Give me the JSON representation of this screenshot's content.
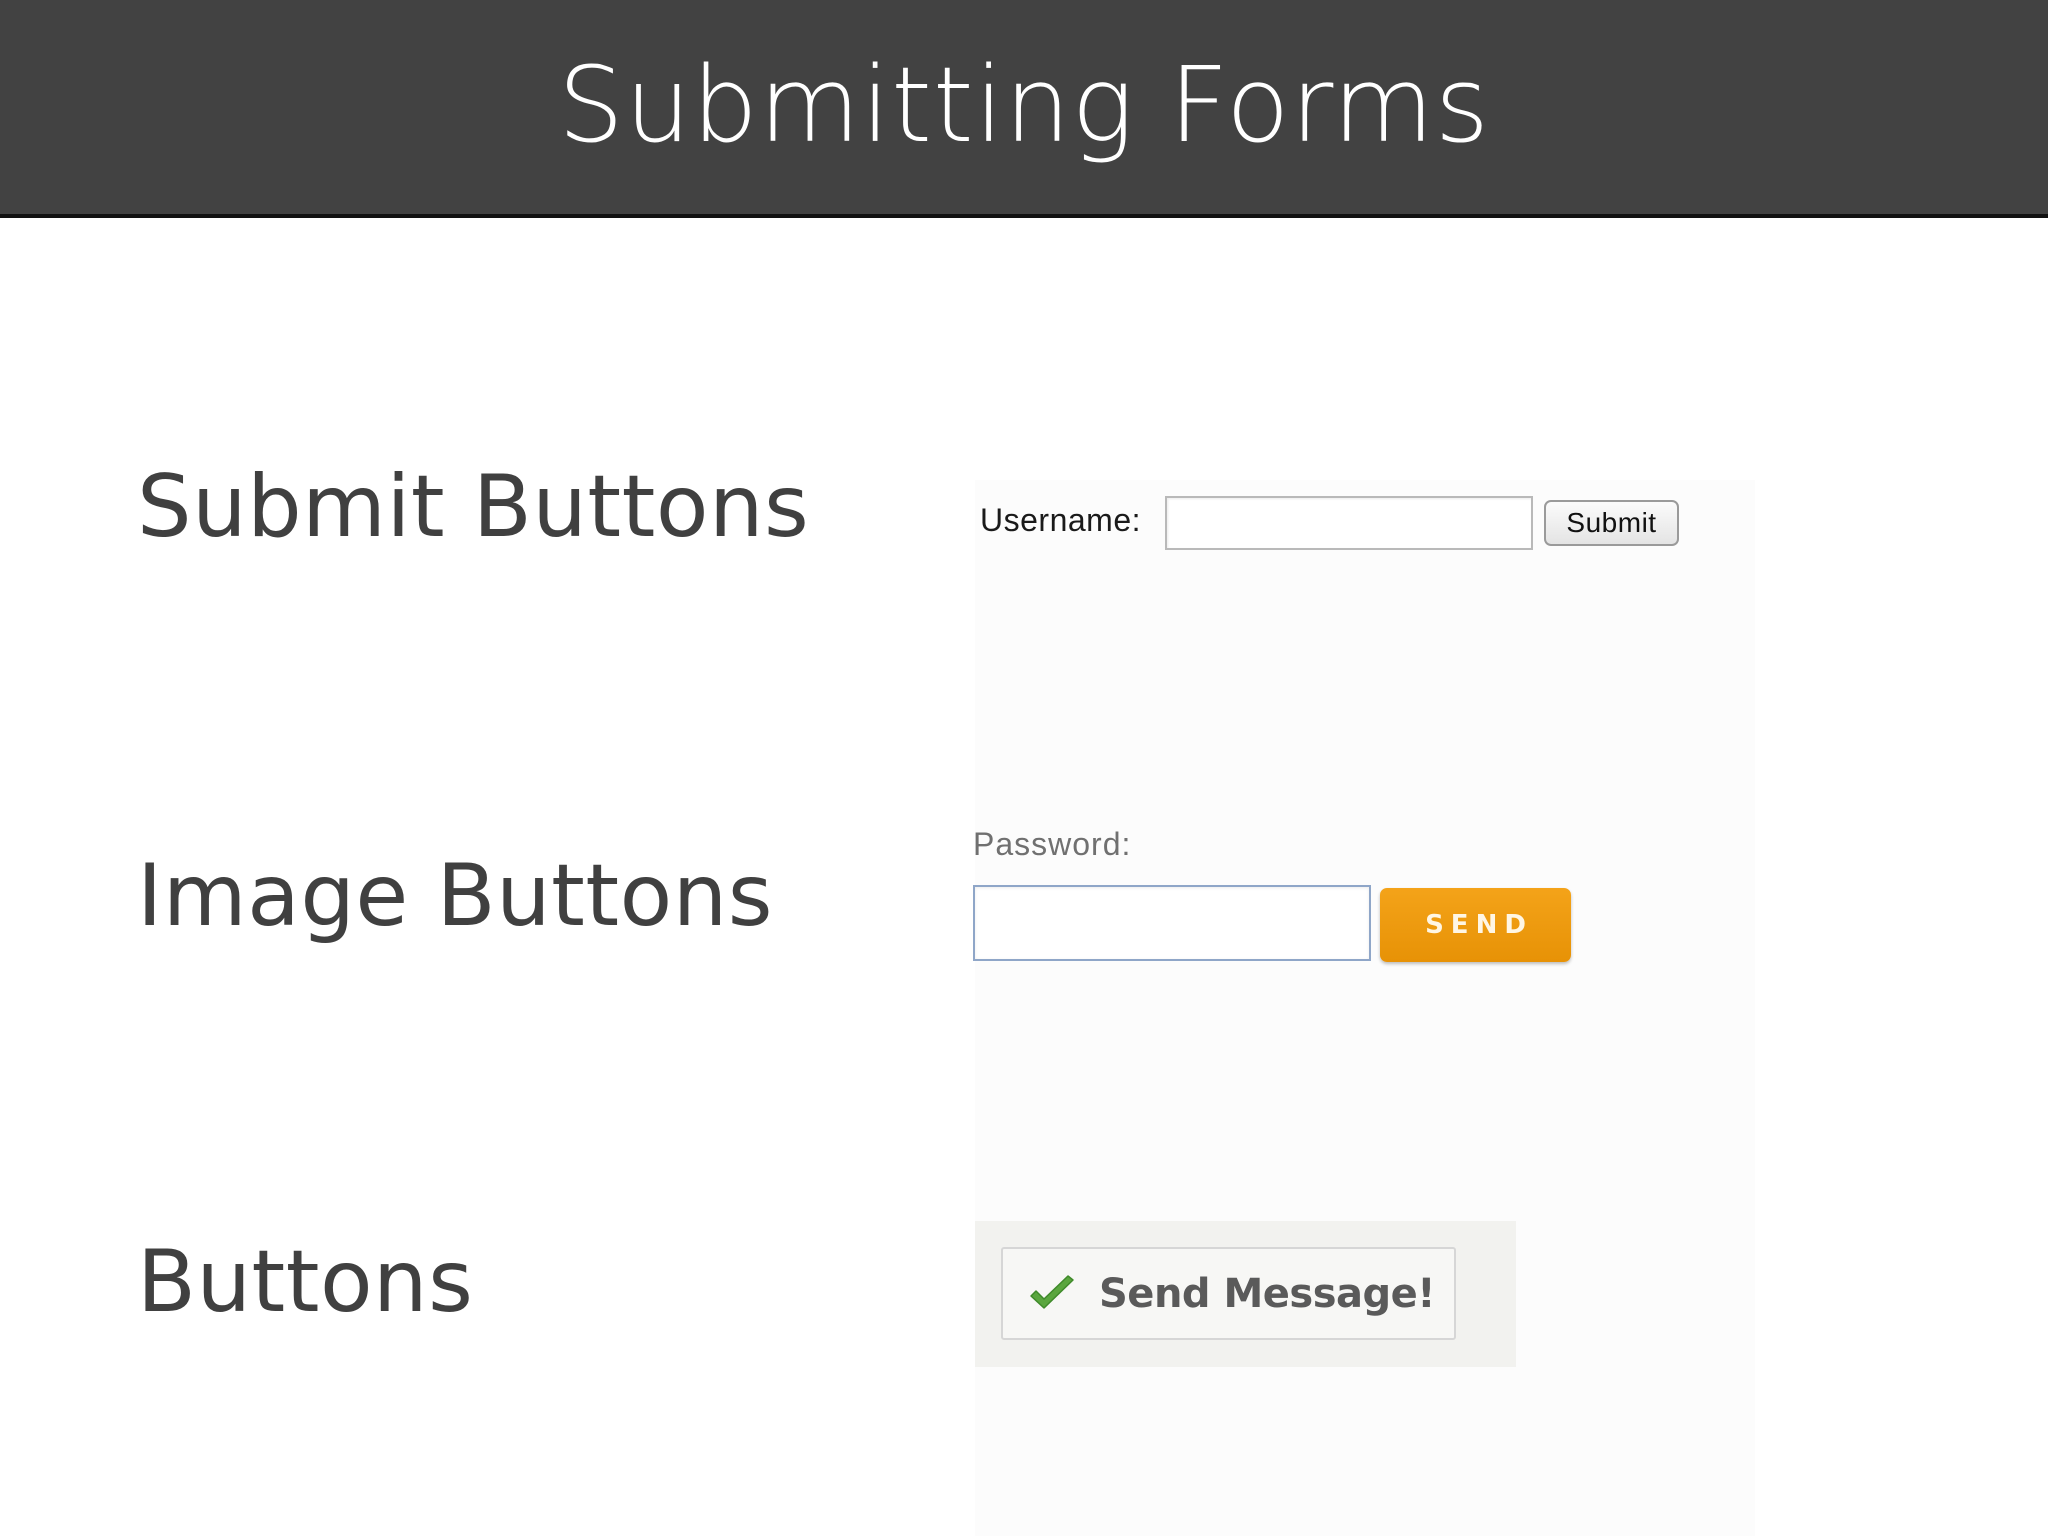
{
  "header": {
    "title": "Submitting Forms"
  },
  "rows": {
    "submit_buttons": {
      "label": "Submit Buttons",
      "field_label": "Username:",
      "field_value": "",
      "button_label": "Submit"
    },
    "image_buttons": {
      "label": "Image Buttons",
      "field_label": "Password:",
      "field_value": "",
      "button_label": "SEND",
      "button_color": "#ef9c0f"
    },
    "buttons": {
      "label": "Buttons",
      "button_label": "Send Message!",
      "button_icon": "checkmark-icon",
      "icon_color": "#5aa63e"
    }
  },
  "colors": {
    "header_bg": "#424242",
    "header_text": "#ffffff",
    "label_text": "#404040"
  }
}
